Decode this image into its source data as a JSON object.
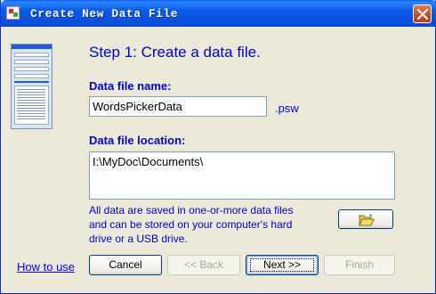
{
  "window": {
    "title": "Create New Data File"
  },
  "step": {
    "heading": "Step 1:  Create a data file."
  },
  "file_name": {
    "label": "Data file name:",
    "value": "WordsPickerData",
    "extension": ".psw"
  },
  "file_location": {
    "label": "Data file location:",
    "value": "I:\\MyDoc\\Documents\\"
  },
  "info_text": {
    "line1": "All data are saved in one-or-more data files",
    "line2": "and can be stored on your computer's hard",
    "line3": "drive or a USB drive."
  },
  "links": {
    "how_to_use": "How to use"
  },
  "buttons": {
    "cancel": "Cancel",
    "back": "<< Back",
    "next": "Next >>",
    "finish": "Finish"
  },
  "colors": {
    "accent_text": "#0000cc",
    "titlebar": "#0a5ae6",
    "dialog_bg": "#ece9d8"
  },
  "icons": {
    "title": "app-icon",
    "close": "close-icon",
    "browse": "folder-open-icon"
  }
}
